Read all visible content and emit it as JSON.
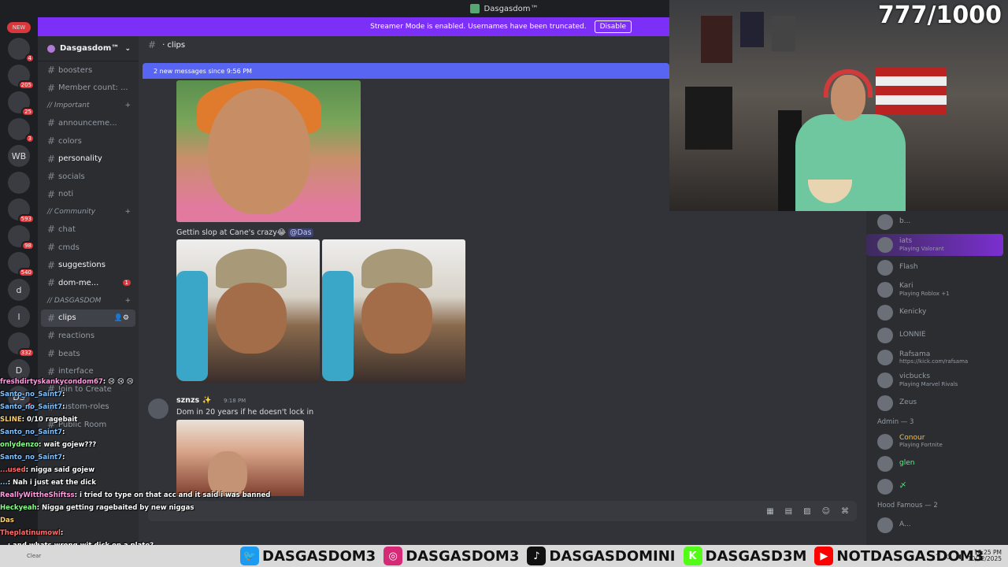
{
  "window": {
    "title": "Dasgasdom™"
  },
  "streamer_banner": {
    "text": "Streamer Mode is enabled. Usernames have been truncated.",
    "disable_label": "Disable"
  },
  "guilds": [
    {
      "label": "NEW",
      "badge": ""
    },
    {
      "label": "",
      "badge": "4"
    },
    {
      "label": "",
      "badge": "205"
    },
    {
      "label": "",
      "badge": "25"
    },
    {
      "label": "",
      "badge": "3"
    },
    {
      "label": "WB",
      "badge": ""
    },
    {
      "label": "",
      "badge": ""
    },
    {
      "label": "",
      "badge": "593"
    },
    {
      "label": "",
      "badge": "98"
    },
    {
      "label": "",
      "badge": "540"
    },
    {
      "label": "d",
      "badge": ""
    },
    {
      "label": "l",
      "badge": ""
    },
    {
      "label": "",
      "badge": "332"
    },
    {
      "label": "D",
      "badge": ""
    },
    {
      "label": "DS",
      "badge": "1"
    }
  ],
  "server": {
    "name": "Dasgasdom™"
  },
  "channels_top": [
    {
      "name": "boosters"
    },
    {
      "name": "Member count: ..."
    }
  ],
  "categories": {
    "important": "// Important",
    "community": "// Community",
    "dasgasdom": "// DASGASDOM"
  },
  "important_channels": [
    {
      "name": "announceme...",
      "unread": false
    },
    {
      "name": "colors",
      "unread": false
    },
    {
      "name": "personality",
      "unread": true
    },
    {
      "name": "socials",
      "unread": false
    },
    {
      "name": "noti",
      "unread": false
    }
  ],
  "community_channels": [
    {
      "name": "chat",
      "unread": false
    },
    {
      "name": "cmds",
      "unread": false
    },
    {
      "name": "suggestions",
      "unread": true
    },
    {
      "name": "dom-me...",
      "unread": true,
      "mentions": "1"
    }
  ],
  "dasgasdom_channels": [
    {
      "name": "clips",
      "active": true
    },
    {
      "name": "reactions"
    },
    {
      "name": "beats"
    },
    {
      "name": "interface"
    },
    {
      "name": "Join to Create"
    },
    {
      "name": "custom-roles"
    },
    {
      "name": "Public Room"
    }
  ],
  "current_channel": {
    "name": "clips"
  },
  "new_messages_bar": "2 new messages since 9:56 PM",
  "messages": {
    "msg1_text": "Gettin slop at Cane's crazy😂",
    "msg1_mention": "@Das",
    "author": "sznzs ✨",
    "timestamp": "9:18 PM",
    "msg2_text": "Dom in 20 years if he doesn't lock in"
  },
  "composer_icons": [
    "gift-icon",
    "gif-icon",
    "sticker-icon",
    "emoji-icon",
    "apps-icon"
  ],
  "members": [
    {
      "name": "b...",
      "activity": ""
    },
    {
      "name": "iats",
      "activity": "Playing Valorant",
      "highlight": true
    },
    {
      "name": "Flash",
      "activity": ""
    },
    {
      "name": "Kari",
      "activity": "Playing Roblox +1"
    },
    {
      "name": "Kenicky",
      "activity": ""
    },
    {
      "name": "LONNIE",
      "activity": ""
    },
    {
      "name": "Rafsama",
      "activity": "https://kick.com/rafsama"
    },
    {
      "name": "vicbucks",
      "activity": "Playing Marvel Rivals"
    },
    {
      "name": "Zeus",
      "activity": ""
    }
  ],
  "admin_group": "Admin — 3",
  "admins": [
    {
      "name": "Conour",
      "activity": "Playing Fortnite"
    },
    {
      "name": "glen",
      "activity": ""
    },
    {
      "name": "〆",
      "activity": ""
    }
  ],
  "hood_group": "Hood Famous — 2",
  "hood": [
    {
      "name": "A...",
      "activity": ""
    }
  ],
  "stream_overlay": {
    "sub_count": "777/1000",
    "chat": [
      {
        "user": "freshdirtyskankycondom67",
        "text": ": 😢 😢 😢"
      },
      {
        "user": "Santo_no_Saint7",
        "text": ":"
      },
      {
        "user": "Santo_no_Saint7",
        "text": ":"
      },
      {
        "user": "SLINE",
        "text": ": 0/10 ragebait"
      },
      {
        "user": "Santo_no_Saint7",
        "text": ":"
      },
      {
        "user": "onlydenzo",
        "text": ": wait gojew???"
      },
      {
        "user": "Santo_no_Saint7",
        "text": ":"
      },
      {
        "user": "...used",
        "text": ": nigga said gojew"
      },
      {
        "user": "...",
        "text": ": Nah i just eat the dick"
      },
      {
        "user": "ReallyWittheShiftss",
        "text": ": i tried to type on that acc and it said i was banned"
      },
      {
        "user": "Heckyeah",
        "text": ": Nigga getting ragebaited by new niggas"
      },
      {
        "user": "Das",
        "text": ""
      },
      {
        "user": "Theplatinumowl",
        "text": ":"
      },
      {
        "user": "...",
        "text": ": and whats wrong wit dick on a plate?"
      }
    ],
    "clear_label": "Clear"
  },
  "socials": [
    {
      "icon": "twitter-icon",
      "color": "#1d9bf0",
      "handle": "DASGASDOM3"
    },
    {
      "icon": "instagram-icon",
      "color": "#d62976",
      "handle": "DASGASDOM3"
    },
    {
      "icon": "tiktok-icon",
      "color": "#111111",
      "handle": "DASGASDOMINI"
    },
    {
      "icon": "kick-icon",
      "color": "#53fc18",
      "handle": "DASGASD3M"
    },
    {
      "icon": "youtube-icon",
      "color": "#ff0000",
      "handle": "NOTDASGASDOM3"
    }
  ],
  "taskbar": {
    "time": "10:25 PM",
    "date": "10/12/2025"
  },
  "colors": {
    "accent": "#5865f2",
    "streamer_bar": "#7b2ff7",
    "mention_red": "#da373c"
  }
}
